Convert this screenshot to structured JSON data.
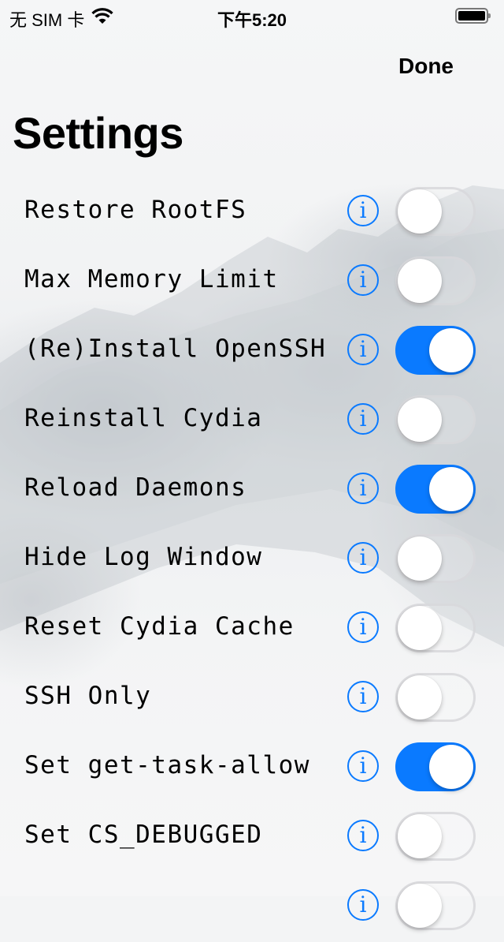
{
  "status_bar": {
    "carrier": "无 SIM 卡",
    "wifi_icon": "wifi-icon",
    "time": "下午5:20",
    "battery_icon": "battery-full-icon"
  },
  "nav": {
    "done_label": "Done"
  },
  "page": {
    "title": "Settings"
  },
  "colors": {
    "accent": "#0A7AFF",
    "toggle_off_border": "#D7D7DA"
  },
  "settings": [
    {
      "label": "Restore RootFS",
      "on": false,
      "info_icon": "info-icon"
    },
    {
      "label": "Max Memory Limit",
      "on": false,
      "info_icon": "info-icon"
    },
    {
      "label": "(Re)Install OpenSSH",
      "on": true,
      "info_icon": "info-icon"
    },
    {
      "label": "Reinstall Cydia",
      "on": false,
      "info_icon": "info-icon"
    },
    {
      "label": "Reload Daemons",
      "on": true,
      "info_icon": "info-icon"
    },
    {
      "label": "Hide Log Window",
      "on": false,
      "info_icon": "info-icon"
    },
    {
      "label": "Reset Cydia Cache",
      "on": false,
      "info_icon": "info-icon"
    },
    {
      "label": "SSH Only",
      "on": false,
      "info_icon": "info-icon"
    },
    {
      "label": "Set get-task-allow",
      "on": true,
      "info_icon": "info-icon"
    },
    {
      "label": "Set CS_DEBUGGED",
      "on": false,
      "info_icon": "info-icon"
    },
    {
      "label": "",
      "on": false,
      "info_icon": "info-icon"
    }
  ]
}
